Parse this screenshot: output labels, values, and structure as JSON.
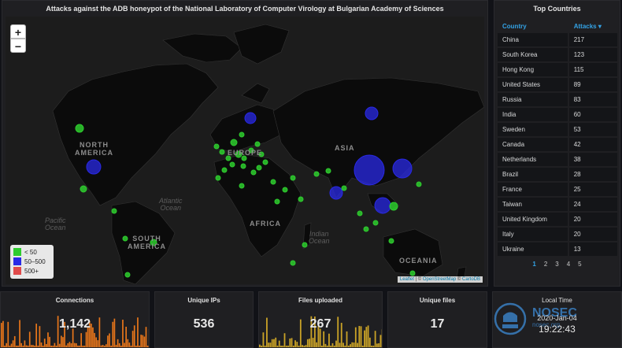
{
  "map": {
    "title": "Attacks against the ADB honeypot of the National Laboratory of Computer Virology at Bulgarian Academy of Sciences",
    "zoom_in": "+",
    "zoom_out": "−",
    "labels": {
      "north_america": "NORTH\nAMERICA",
      "europe": "EUROPE",
      "asia": "ASIA",
      "africa": "AFRICA",
      "south_america": "SOUTH\nAMERICA",
      "oceania": "OCEANIA"
    },
    "oceans": {
      "atlantic": "Atlantic\nOcean",
      "pacific": "Pacific\nOcean",
      "indian": "Indian\nOcean"
    },
    "legend": [
      {
        "label": "< 50",
        "color": "#2ecc2e"
      },
      {
        "label": "50–500",
        "color": "#2929e6"
      },
      {
        "label": "500+",
        "color": "#e04a4a"
      }
    ],
    "attribution": {
      "leaflet": "Leaflet",
      "sep": " | © ",
      "osm": "OpenStreetMap",
      "sep2": " © ",
      "carto": "CartoDB"
    }
  },
  "countries": {
    "title": "Top Countries",
    "col_country": "Country",
    "col_attacks": "Attacks ▾",
    "rows": [
      {
        "country": "China",
        "attacks": "217"
      },
      {
        "country": "South Korea",
        "attacks": "123"
      },
      {
        "country": "Hong Kong",
        "attacks": "115"
      },
      {
        "country": "United States",
        "attacks": "89"
      },
      {
        "country": "Russia",
        "attacks": "83"
      },
      {
        "country": "India",
        "attacks": "60"
      },
      {
        "country": "Sweden",
        "attacks": "53"
      },
      {
        "country": "Canada",
        "attacks": "42"
      },
      {
        "country": "Netherlands",
        "attacks": "38"
      },
      {
        "country": "Brazil",
        "attacks": "28"
      },
      {
        "country": "France",
        "attacks": "25"
      },
      {
        "country": "Taiwan",
        "attacks": "24"
      },
      {
        "country": "United Kingdom",
        "attacks": "20"
      },
      {
        "country": "Italy",
        "attacks": "20"
      },
      {
        "country": "Ukraine",
        "attacks": "13"
      }
    ],
    "pages": [
      "1",
      "2",
      "3",
      "4",
      "5"
    ],
    "active_page": "1"
  },
  "stats": {
    "connections": {
      "title": "Connections",
      "value": "1,142",
      "color": "#e8761a"
    },
    "unique_ips": {
      "title": "Unique IPs",
      "value": "536"
    },
    "files_uploaded": {
      "title": "Files uploaded",
      "value": "267",
      "color": "#c9a227"
    },
    "unique_files": {
      "title": "Unique files",
      "value": "17"
    }
  },
  "clock": {
    "title": "Local Time",
    "date": "2020-Jan-04",
    "time": "19:22:43",
    "watermark": "NOSEC",
    "watermark_sub": "nosec.org"
  }
}
